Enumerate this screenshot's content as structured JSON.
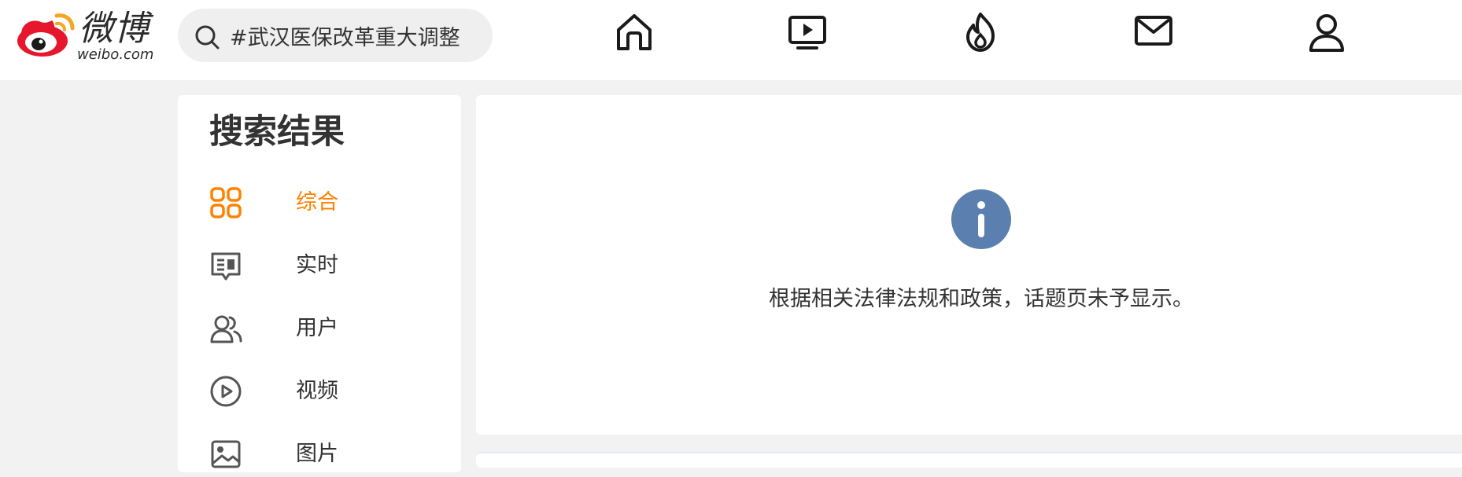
{
  "header": {
    "logo_cn": "微博",
    "logo_en": "weibo.com",
    "search": {
      "value": "#武汉医保改革重大调整"
    },
    "nav_icons": [
      "home-icon",
      "video-icon",
      "hot-icon",
      "mail-icon",
      "profile-icon"
    ]
  },
  "sidebar": {
    "title": "搜索结果",
    "items": [
      {
        "label": "综合",
        "icon": "grid-icon",
        "active": true
      },
      {
        "label": "实时",
        "icon": "realtime-icon",
        "active": false
      },
      {
        "label": "用户",
        "icon": "users-icon",
        "active": false
      },
      {
        "label": "视频",
        "icon": "play-circle-icon",
        "active": false
      },
      {
        "label": "图片",
        "icon": "image-icon",
        "active": false
      }
    ]
  },
  "main": {
    "notice": "根据相关法律法规和政策，话题页未予显示。",
    "info_icon": "info-icon"
  },
  "colors": {
    "accent": "#ff8200",
    "info_blue": "#5b7fae",
    "brand_red": "#e6162d",
    "background": "#f2f2f2",
    "text": "#333333"
  }
}
